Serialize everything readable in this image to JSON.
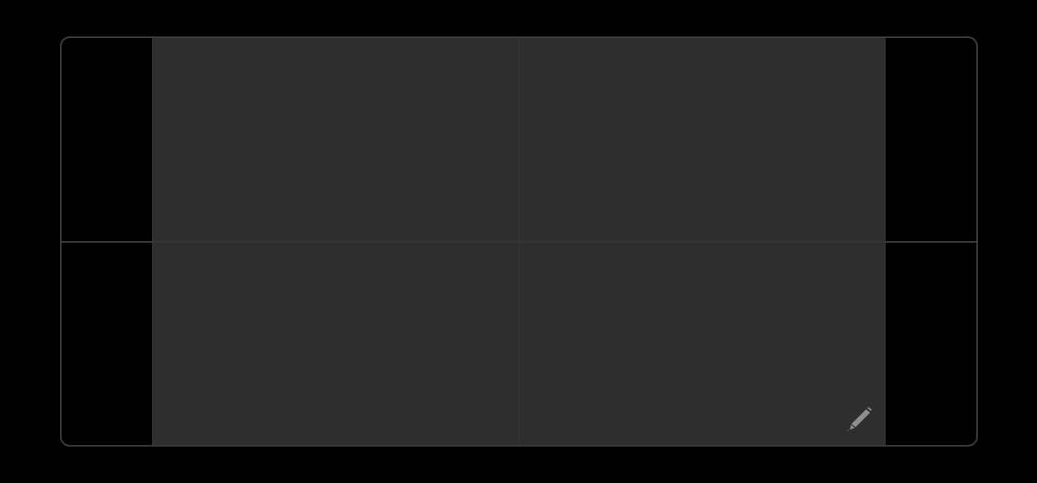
{
  "edit_control": {
    "kind": "pencil"
  }
}
